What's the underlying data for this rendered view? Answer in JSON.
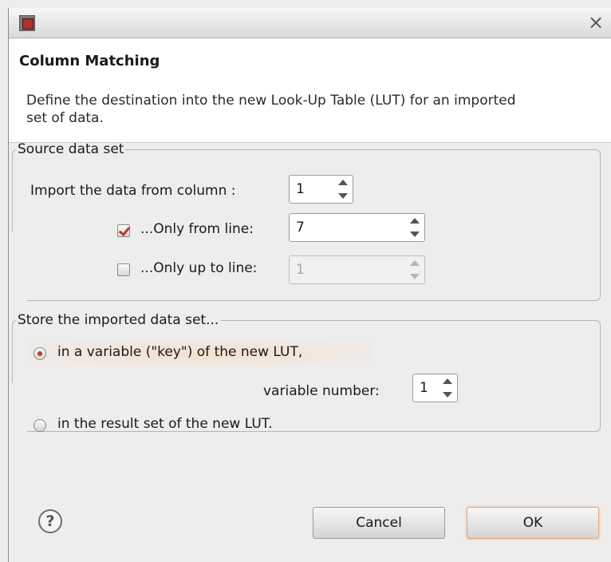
{
  "window": {
    "title": "",
    "close_glyph": "×",
    "app_icon": "application-icon"
  },
  "header": {
    "title": "Column Matching",
    "description": "Define the destination into the new Look-Up Table (LUT) for an imported set of data."
  },
  "source_group": {
    "legend": "Source data set",
    "column_label": "Import the data from column :",
    "column_value": "1",
    "only_from": {
      "label": "...Only from line:",
      "checked": true,
      "value": "7"
    },
    "only_up_to": {
      "label": "...Only up to line:",
      "checked": false,
      "value": "1",
      "enabled": false
    }
  },
  "store_group": {
    "legend": "Store the imported data set...",
    "option_variable": {
      "label": "in a variable (\"key\") of the new LUT,",
      "selected": true
    },
    "variable_number_label": "variable number:",
    "variable_number_value": "1",
    "option_result": {
      "label": "in the result set of the new LUT.",
      "selected": false
    }
  },
  "footer": {
    "help_glyph": "?",
    "cancel_label": "Cancel",
    "ok_label": "OK"
  },
  "colors": {
    "accent": "#c0392b",
    "default_button_glow": "#e3a87c",
    "background": "#ededed"
  }
}
